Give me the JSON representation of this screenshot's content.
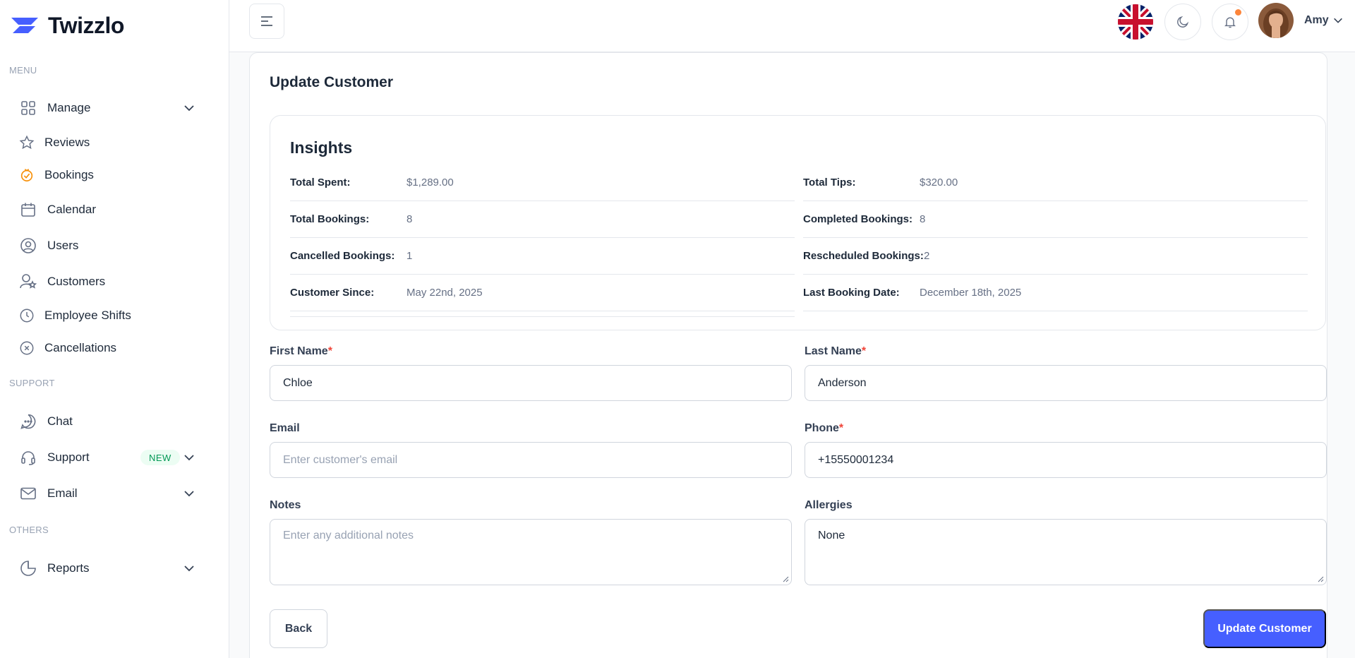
{
  "app": {
    "name": "Twizzlo"
  },
  "sidebar": {
    "groups": [
      "MENU",
      "SUPPORT",
      "OTHERS"
    ],
    "items": [
      {
        "label": "Manage",
        "icon": "grid-icon",
        "has_chevron": true
      },
      {
        "label": "Reviews",
        "icon": "star-icon"
      },
      {
        "label": "Bookings",
        "icon": "bookings-icon"
      },
      {
        "label": "Calendar",
        "icon": "calendar-icon"
      },
      {
        "label": "Users",
        "icon": "user-circle-icon"
      },
      {
        "label": "Customers",
        "icon": "customers-icon"
      },
      {
        "label": "Employee Shifts",
        "icon": "clock-icon"
      },
      {
        "label": "Cancellations",
        "icon": "cancel-circle-icon"
      },
      {
        "label": "Chat",
        "icon": "chat-icon"
      },
      {
        "label": "Support",
        "icon": "headset-icon",
        "badge": "NEW",
        "has_chevron": true
      },
      {
        "label": "Email",
        "icon": "mail-icon",
        "has_chevron": true
      },
      {
        "label": "Reports",
        "icon": "pie-chart-icon",
        "has_chevron": true
      }
    ]
  },
  "header": {
    "user_name": "Amy",
    "language_flag": "uk-flag-icon",
    "has_notification": true
  },
  "page": {
    "title": "Update Customer",
    "insights": {
      "title": "Insights",
      "rows": [
        {
          "label": "Total Spent:",
          "value": "$1,289.00"
        },
        {
          "label": "Total Tips:",
          "value": "$320.00"
        },
        {
          "label": "Total Bookings:",
          "value": "8"
        },
        {
          "label": "Completed Bookings:",
          "value": "8"
        },
        {
          "label": "Cancelled Bookings:",
          "value": "1"
        },
        {
          "label": "Rescheduled Bookings:",
          "value": "2"
        },
        {
          "label": "Customer Since:",
          "value": "May 22nd, 2025"
        },
        {
          "label": "Last Booking Date:",
          "value": "December 18th, 2025"
        }
      ]
    },
    "form": {
      "first_name": {
        "label": "First Name",
        "required": "*",
        "value": "Chloe"
      },
      "last_name": {
        "label": "Last Name",
        "required": "*",
        "value": "Anderson"
      },
      "email": {
        "label": "Email",
        "value": "",
        "placeholder": "Enter customer's email"
      },
      "phone": {
        "label": "Phone",
        "required": "*",
        "value": "+15550001234"
      },
      "notes": {
        "label": "Notes",
        "value": "",
        "placeholder": "Enter any additional notes"
      },
      "allergies": {
        "label": "Allergies",
        "value": "None"
      }
    },
    "actions": {
      "back_label": "Back",
      "submit_label": "Update Customer"
    }
  },
  "colors": {
    "primary": "#465fff",
    "required": "#f04438",
    "badge_bg": "#ecfdf3",
    "badge_text": "#039855",
    "notification_dot": "#fd853a",
    "bookings_icon": "#f79009"
  }
}
